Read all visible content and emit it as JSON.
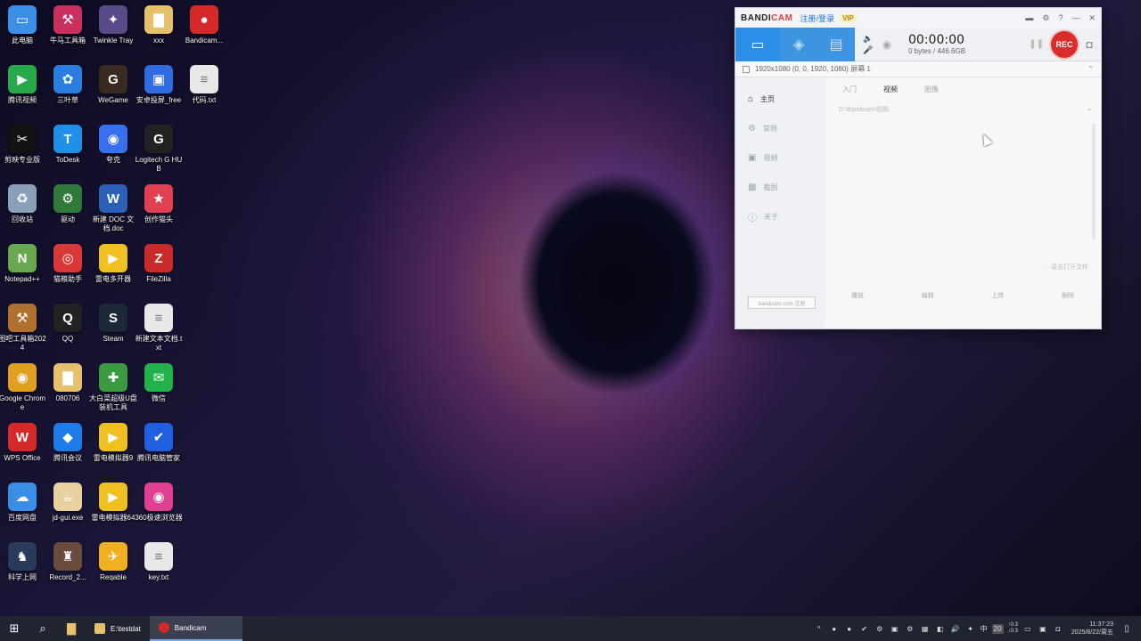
{
  "desktop": {
    "icons": [
      {
        "label": "此电脑",
        "glyph": "▭",
        "color": "#3a8ee6",
        "col": 0,
        "row": 0
      },
      {
        "label": "牛马工具箱",
        "glyph": "⚒",
        "color": "#c93060",
        "col": 1,
        "row": 0
      },
      {
        "label": "Twinkle Tray",
        "glyph": "✦",
        "color": "#5b4a8a",
        "col": 2,
        "row": 0
      },
      {
        "label": "xxx",
        "glyph": "▇",
        "color": "#e6c06a",
        "col": 3,
        "row": 0
      },
      {
        "label": "Bandicam...",
        "glyph": "●",
        "color": "#d42a2a",
        "col": 4,
        "row": 0
      },
      {
        "label": "腾讯视频",
        "glyph": "▶",
        "color": "#27a84a",
        "col": 0,
        "row": 1
      },
      {
        "label": "三叶草",
        "glyph": "✿",
        "color": "#2b7de0",
        "col": 1,
        "row": 1
      },
      {
        "label": "WeGame",
        "glyph": "G",
        "color": "#3a2a20",
        "col": 2,
        "row": 1
      },
      {
        "label": "安卓投屏_free",
        "glyph": "▣",
        "color": "#2f6de0",
        "col": 3,
        "row": 1
      },
      {
        "label": "代码.txt",
        "glyph": "≡",
        "color": "#e8e8e8",
        "col": 4,
        "row": 1
      },
      {
        "label": "剪映专业版",
        "glyph": "✂",
        "color": "#111111",
        "col": 0,
        "row": 2
      },
      {
        "label": "ToDesk",
        "glyph": "T",
        "color": "#1e90e8",
        "col": 1,
        "row": 2
      },
      {
        "label": "夸克",
        "glyph": "◉",
        "color": "#3a6ef0",
        "col": 2,
        "row": 2
      },
      {
        "label": "Logitech G HUB",
        "glyph": "G",
        "color": "#222222",
        "col": 3,
        "row": 2
      },
      {
        "label": "回收站",
        "glyph": "♻",
        "color": "#8aa0b8",
        "col": 0,
        "row": 3
      },
      {
        "label": "驱动",
        "glyph": "⚙",
        "color": "#2f7a3a",
        "col": 1,
        "row": 3
      },
      {
        "label": "新建 DOC 文档.doc",
        "glyph": "W",
        "color": "#2b5fb8",
        "col": 2,
        "row": 3
      },
      {
        "label": "创作猫头",
        "glyph": "★",
        "color": "#e04050",
        "col": 3,
        "row": 3
      },
      {
        "label": "Notepad++",
        "glyph": "N",
        "color": "#6aa84f",
        "col": 0,
        "row": 4
      },
      {
        "label": "猫粮助手",
        "glyph": "◎",
        "color": "#d83838",
        "col": 1,
        "row": 4
      },
      {
        "label": "雷电多开器",
        "glyph": "▶",
        "color": "#f0c020",
        "col": 2,
        "row": 4
      },
      {
        "label": "FileZilla",
        "glyph": "Z",
        "color": "#c92a2a",
        "col": 3,
        "row": 4
      },
      {
        "label": "图吧工具箱2024",
        "glyph": "⚒",
        "color": "#b07030",
        "col": 0,
        "row": 5
      },
      {
        "label": "QQ",
        "glyph": "Q",
        "color": "#222222",
        "col": 1,
        "row": 5
      },
      {
        "label": "Steam",
        "glyph": "S",
        "color": "#1b2838",
        "col": 2,
        "row": 5
      },
      {
        "label": "新建文本文档.txt",
        "glyph": "≡",
        "color": "#e8e8e8",
        "col": 3,
        "row": 5
      },
      {
        "label": "Google Chrome",
        "glyph": "◉",
        "color": "#e0a020",
        "col": 0,
        "row": 6
      },
      {
        "label": "080706",
        "glyph": "▇",
        "color": "#e6c06a",
        "col": 1,
        "row": 6
      },
      {
        "label": "大白菜超级U盘装机工具",
        "glyph": "✚",
        "color": "#3a9a40",
        "col": 2,
        "row": 6
      },
      {
        "label": "微信",
        "glyph": "✉",
        "color": "#21b34a",
        "col": 3,
        "row": 6
      },
      {
        "label": "WPS Office",
        "glyph": "W",
        "color": "#d62a2a",
        "col": 0,
        "row": 7
      },
      {
        "label": "腾讯会议",
        "glyph": "◆",
        "color": "#1e7ce8",
        "col": 1,
        "row": 7
      },
      {
        "label": "雷电模拟器9",
        "glyph": "▶",
        "color": "#f0c020",
        "col": 2,
        "row": 7
      },
      {
        "label": "腾讯电脑管家",
        "glyph": "✔",
        "color": "#2060e0",
        "col": 3,
        "row": 7
      },
      {
        "label": "百度网盘",
        "glyph": "☁",
        "color": "#3a8ee6",
        "col": 0,
        "row": 8
      },
      {
        "label": "jd-gui.exe",
        "glyph": "☕",
        "color": "#e8d0a0",
        "col": 1,
        "row": 8
      },
      {
        "label": "雷电模拟器64",
        "glyph": "▶",
        "color": "#f0c020",
        "col": 2,
        "row": 8
      },
      {
        "label": "360极速浏览器",
        "glyph": "◉",
        "color": "#e04090",
        "col": 3,
        "row": 8
      },
      {
        "label": "科学上网",
        "glyph": "♞",
        "color": "#2a3a5a",
        "col": 0,
        "row": 9
      },
      {
        "label": "Record_2...",
        "glyph": "♜",
        "color": "#6a4a3a",
        "col": 1,
        "row": 9
      },
      {
        "label": "Reqable",
        "glyph": "✈",
        "color": "#f0b020",
        "col": 2,
        "row": 9
      },
      {
        "label": "key.txt",
        "glyph": "≡",
        "color": "#e8e8e8",
        "col": 3,
        "row": 9
      }
    ]
  },
  "bandicam": {
    "logo_a": "BANDI",
    "logo_b": "CAM",
    "register": "注册/登录",
    "vip": "VIP",
    "title_icons": [
      "folder-icon",
      "gear-icon",
      "help-icon",
      "minimize-icon",
      "close-icon"
    ],
    "title_glyphs": [
      "▬",
      "⚙",
      "?",
      "—",
      "✕"
    ],
    "modes": [
      {
        "name": "screen-mode",
        "glyph": "▭"
      },
      {
        "name": "game-mode",
        "glyph": "◈"
      },
      {
        "name": "device-mode",
        "glyph": "▤"
      }
    ],
    "timer": "00:00:00",
    "size": "0 bytes / 446.6GB",
    "pause_glyph": "❚❚",
    "rec_label": "REC",
    "snap_glyph": "◘",
    "region": "1920x1080  (0, 0, 1920, 1080)  屏幕 1",
    "sidebar": [
      {
        "label": "主页",
        "glyph": "⌂"
      },
      {
        "label": "常规",
        "glyph": "⚙"
      },
      {
        "label": "视频",
        "glyph": "▣"
      },
      {
        "label": "截图",
        "glyph": "▦"
      },
      {
        "label": "关于",
        "glyph": "ⓘ"
      }
    ],
    "tabs": [
      "入门",
      "视频",
      "图像"
    ],
    "path": "D:\\Bandicam\\视频",
    "hint": "- 双击打开文件",
    "bottom_buttons": [
      "播放",
      "编辑",
      "上传",
      "删除"
    ],
    "upgrade_label": "bandicam.com 注册"
  },
  "taskbar": {
    "apps": [
      {
        "label": "E:\\testdat",
        "color": "#e6c06a",
        "active": false
      },
      {
        "label": "Bandicam",
        "color": "#d42a2a",
        "active": true
      }
    ],
    "temp": "20",
    "net_up": "0.3",
    "net_down": "0.3",
    "time": "11:37:23",
    "date": "2025/8/22/周五",
    "ime": "中",
    "tray_glyphs": [
      "^",
      "●",
      "●",
      "✔",
      "⚙",
      "▣",
      "⚙",
      "▦",
      "◧",
      "🔊",
      "✦"
    ]
  }
}
